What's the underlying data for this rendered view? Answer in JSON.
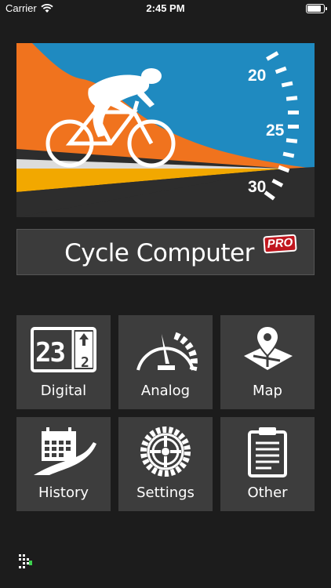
{
  "status_bar": {
    "carrier": "Carrier",
    "time": "2:45 PM"
  },
  "hero": {
    "speed_ticks": [
      "20",
      "25",
      "30"
    ],
    "colors": {
      "sky": "#1f8ac0",
      "hill": "#f0731e",
      "road": "#2d2d2d",
      "light": "#f2a800",
      "rider": "#ffffff"
    }
  },
  "app": {
    "title": "Cycle Computer",
    "badge": "PRO",
    "badge_color": "#c0161e"
  },
  "tiles": [
    {
      "label": "Digital",
      "icon": "digital-display-icon"
    },
    {
      "label": "Analog",
      "icon": "speedometer-icon"
    },
    {
      "label": "Map",
      "icon": "map-pin-icon"
    },
    {
      "label": "History",
      "icon": "calendar-road-icon"
    },
    {
      "label": "Settings",
      "icon": "gear-wheel-icon"
    },
    {
      "label": "Other",
      "icon": "clipboard-icon"
    }
  ],
  "digital_icon": {
    "big": "23",
    "small": "2"
  }
}
